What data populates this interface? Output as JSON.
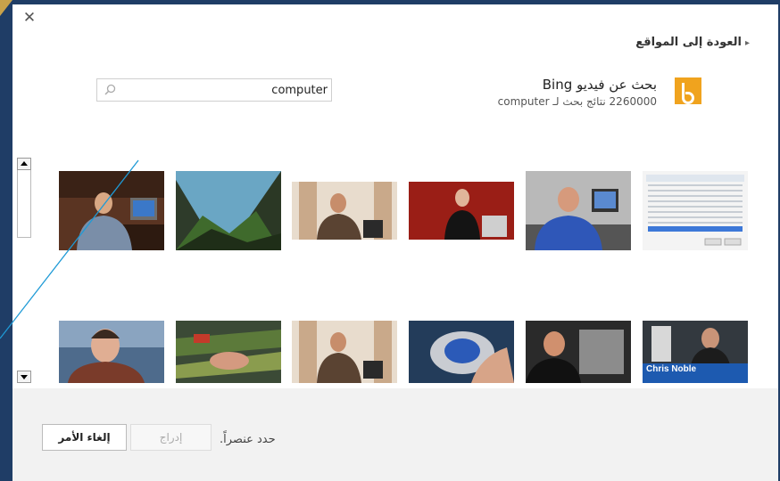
{
  "dialog": {
    "back_link": "العودة إلى المواقع",
    "search": {
      "value": "computer"
    },
    "provider": {
      "title": "بحث عن فيديو Bing",
      "results": "2260000 نتائج بحث لـ computer"
    },
    "thumbs": [
      {
        "id": "t1",
        "caption": ""
      },
      {
        "id": "t2",
        "caption": ""
      },
      {
        "id": "t3",
        "caption": ""
      },
      {
        "id": "t4",
        "caption": ""
      },
      {
        "id": "t5",
        "caption": ""
      },
      {
        "id": "t6",
        "caption": ""
      },
      {
        "id": "t7",
        "caption": ""
      },
      {
        "id": "t8",
        "caption": ""
      },
      {
        "id": "t9",
        "caption": ""
      },
      {
        "id": "t10",
        "caption": ""
      },
      {
        "id": "t11",
        "caption": ""
      },
      {
        "id": "t12",
        "caption": "Chris Noble"
      }
    ],
    "footer": {
      "status": "حدد عنصراً.",
      "insert_label": "إدراج",
      "cancel_label": "إلغاء الأمر"
    }
  },
  "icons": {
    "close": "close-icon",
    "search": "search-icon",
    "bing": "bing-logo-icon",
    "back": "chevron-right-icon",
    "scroll_up": "scroll-up-arrow-icon",
    "scroll_down": "scroll-down-arrow-icon"
  },
  "colors": {
    "bing_accent": "#f0a31e",
    "frame": "#1f3d66",
    "footer_bg": "#f2f2f2"
  }
}
